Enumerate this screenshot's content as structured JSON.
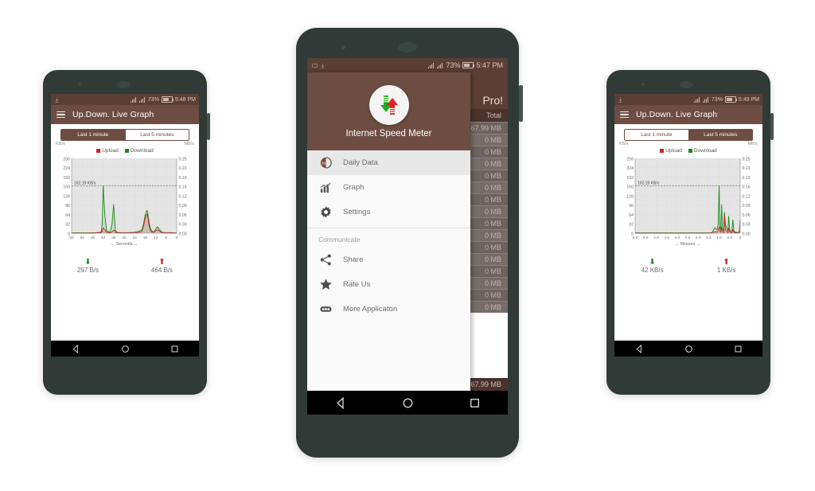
{
  "app": {
    "name": "Internet Speed Meter",
    "toolbar_title": "Up.Down. Live Graph",
    "accent": "#6d4c41",
    "status_accent": "#5b3f35",
    "upload_color": "#d32020",
    "download_color": "#1a8a1a"
  },
  "phones": {
    "left": {
      "status": {
        "battery": "73%",
        "time": "5:48 PM",
        "battery_icon": "battery-icon",
        "signal_icon": "signal-icon"
      },
      "toolbar": {
        "menu_icon": "hamburger-icon",
        "title": "Up.Down. Live Graph"
      },
      "tabs": [
        {
          "label": "Last 1 minute",
          "selected": true
        },
        {
          "label": "Last 5 minutes",
          "selected": false
        }
      ],
      "units": {
        "left": "KB/s",
        "right": "MB/s"
      },
      "legend": [
        {
          "label": "Upload",
          "color": "#d32020"
        },
        {
          "label": "Download",
          "color": "#1a8a1a"
        }
      ],
      "peak_label": "162.19 KB/s",
      "stats": {
        "download": {
          "icon": "download-arrow-icon",
          "value": "297 B/s"
        },
        "upload": {
          "icon": "upload-arrow-icon",
          "value": "464 B/s"
        }
      },
      "nav": {
        "back": "back-icon",
        "home": "home-icon",
        "recents": "recents-icon"
      }
    },
    "center": {
      "status": {
        "battery": "73%",
        "time": "5:47 PM",
        "battery_icon": "battery-icon",
        "signal_icon": "signal-icon"
      },
      "background": {
        "title": "Pro!",
        "column_header": "Total",
        "rows": [
          "67.99 MB",
          "0 MB",
          "0 MB",
          "0 MB",
          "0 MB",
          "0 MB",
          "0 MB",
          "0 MB",
          "0 MB",
          "0 MB",
          "0 MB",
          "0 MB",
          "0 MB",
          "0 MB",
          "0 MB",
          "0 MB"
        ],
        "footer_total": "67.99 MB"
      },
      "drawer": {
        "app_title": "Internet Speed Meter",
        "logo_icon": "speed-meter-logo-icon",
        "items": [
          {
            "label": "Daily Data",
            "icon": "daily-data-icon",
            "selected": true
          },
          {
            "label": "Graph",
            "icon": "bar-chart-icon",
            "selected": false
          },
          {
            "label": "Settings",
            "icon": "gear-icon",
            "selected": false
          }
        ],
        "section_label": "Communicate",
        "comm_items": [
          {
            "label": "Share",
            "icon": "share-icon"
          },
          {
            "label": "Rate Us",
            "icon": "star-icon"
          },
          {
            "label": "More Applicaton",
            "icon": "more-apps-icon"
          }
        ]
      },
      "nav": {
        "back": "back-icon",
        "home": "home-icon",
        "recents": "recents-icon"
      }
    },
    "right": {
      "status": {
        "battery": "73%",
        "time": "5:49 PM",
        "battery_icon": "battery-icon",
        "signal_icon": "signal-icon"
      },
      "toolbar": {
        "menu_icon": "hamburger-icon",
        "title": "Up.Down. Live Graph"
      },
      "tabs": [
        {
          "label": "Last 1 minute",
          "selected": false
        },
        {
          "label": "Last 5 minutes",
          "selected": true
        }
      ],
      "units": {
        "left": "KB/s",
        "right": "MB/s"
      },
      "legend": [
        {
          "label": "Upload",
          "color": "#d32020"
        },
        {
          "label": "Download",
          "color": "#1a8a1a"
        }
      ],
      "peak_label": "162.19 KB/s",
      "stats": {
        "download": {
          "icon": "download-arrow-icon",
          "value": "42 KB/s"
        },
        "upload": {
          "icon": "upload-arrow-icon",
          "value": "1 KB/s"
        }
      },
      "nav": {
        "back": "back-icon",
        "home": "home-icon",
        "recents": "recents-icon"
      }
    }
  },
  "chart_data": [
    {
      "id": "left-live-graph",
      "type": "line",
      "title": "",
      "xlabel": "← Seconds →",
      "ylabel": "KB/s",
      "y2label": "MB/s",
      "xlim": [
        60,
        0
      ],
      "ylim": [
        0,
        256
      ],
      "y2lim": [
        0.0,
        0.25
      ],
      "grid": true,
      "legend": [
        "Upload",
        "Download"
      ],
      "annotation": "162.19 KB/s",
      "annotation_y": 162.19,
      "xticks": [
        60,
        54,
        48,
        42,
        36,
        30,
        24,
        18,
        12,
        6,
        0
      ],
      "yticks": [
        0,
        32,
        64,
        96,
        128,
        160,
        192,
        224,
        256
      ],
      "y2ticks": [
        "0.00",
        "0.03",
        "0.06",
        "0.09",
        "0.12",
        "0.16",
        "0.19",
        "0.22",
        "0.25"
      ],
      "series": [
        {
          "name": "Download",
          "color": "#1a8a1a",
          "x": [
            60,
            55,
            50,
            46,
            44,
            43,
            42.5,
            42,
            41,
            40,
            38,
            37,
            36,
            35.5,
            35,
            34,
            32,
            28,
            24,
            22,
            20,
            19,
            18,
            17,
            16.5,
            16,
            15,
            14,
            13,
            12,
            11,
            10,
            9,
            8,
            7,
            6,
            5,
            4,
            3,
            2,
            1,
            0
          ],
          "y": [
            1,
            1,
            1,
            2,
            3,
            6,
            40,
            162,
            60,
            8,
            3,
            30,
            98,
            55,
            10,
            3,
            2,
            2,
            3,
            6,
            10,
            30,
            62,
            78,
            70,
            46,
            16,
            6,
            5,
            14,
            22,
            14,
            6,
            3,
            2,
            2,
            2,
            2,
            2,
            2,
            1,
            1
          ]
        },
        {
          "name": "Upload",
          "color": "#d32020",
          "x": [
            60,
            55,
            50,
            46,
            44,
            43,
            42.5,
            42,
            41,
            40,
            38,
            37,
            36,
            35.5,
            35,
            34,
            32,
            28,
            24,
            22,
            20,
            19,
            18,
            17,
            16.5,
            16,
            15,
            14,
            13,
            12,
            11,
            10,
            9,
            8,
            7,
            6,
            5,
            4,
            3,
            2,
            1,
            0
          ],
          "y": [
            0,
            0,
            0,
            1,
            1,
            2,
            8,
            18,
            12,
            3,
            1,
            4,
            10,
            9,
            3,
            1,
            1,
            1,
            1,
            2,
            5,
            22,
            50,
            66,
            58,
            32,
            8,
            3,
            3,
            8,
            12,
            8,
            3,
            2,
            1,
            1,
            1,
            1,
            1,
            1,
            0,
            0
          ]
        }
      ]
    },
    {
      "id": "right-live-graph",
      "type": "line",
      "title": "",
      "xlabel": "← Minutes →",
      "ylabel": "KB/s",
      "y2label": "MB/s",
      "xlim": [
        5.0,
        0
      ],
      "ylim": [
        0,
        256
      ],
      "y2lim": [
        0.0,
        0.25
      ],
      "grid": true,
      "legend": [
        "Upload",
        "Download"
      ],
      "annotation": "162.19 KB/s",
      "annotation_y": 162.19,
      "xticks": [
        "5.0",
        "4.5",
        "4.0",
        "3.5",
        "3.0",
        "2.5",
        "2.0",
        "1.5",
        "1.0",
        "0.5",
        "0"
      ],
      "yticks": [
        0,
        32,
        64,
        96,
        128,
        160,
        192,
        224,
        256
      ],
      "y2ticks": [
        "0.00",
        "0.03",
        "0.06",
        "0.09",
        "0.12",
        "0.16",
        "0.19",
        "0.22",
        "0.25"
      ],
      "series": [
        {
          "name": "Download",
          "color": "#1a8a1a",
          "x": [
            5.0,
            4.5,
            4.0,
            3.5,
            3.0,
            2.5,
            2.0,
            1.6,
            1.35,
            1.2,
            1.1,
            1.05,
            1.0,
            0.97,
            0.92,
            0.88,
            0.85,
            0.8,
            0.78,
            0.75,
            0.7,
            0.62,
            0.58,
            0.55,
            0.5,
            0.45,
            0.4,
            0.35,
            0.3,
            0.25,
            0.2,
            0.15,
            0.1,
            0.05,
            0
          ],
          "y": [
            1,
            1,
            1,
            1,
            1,
            1,
            1,
            1,
            2,
            18,
            12,
            30,
            162,
            30,
            10,
            98,
            20,
            8,
            14,
            72,
            30,
            12,
            8,
            58,
            12,
            6,
            4,
            46,
            8,
            4,
            3,
            3,
            3,
            2,
            44
          ]
        },
        {
          "name": "Upload",
          "color": "#d32020",
          "x": [
            5.0,
            4.5,
            4.0,
            3.5,
            3.0,
            2.5,
            2.0,
            1.6,
            1.35,
            1.2,
            1.1,
            1.05,
            1.0,
            0.97,
            0.92,
            0.88,
            0.85,
            0.8,
            0.78,
            0.75,
            0.7,
            0.62,
            0.58,
            0.55,
            0.5,
            0.45,
            0.4,
            0.35,
            0.3,
            0.25,
            0.2,
            0.15,
            0.1,
            0.05,
            0
          ],
          "y": [
            0,
            0,
            0,
            0,
            0,
            0,
            0,
            0,
            1,
            5,
            4,
            8,
            22,
            8,
            3,
            20,
            6,
            2,
            4,
            62,
            10,
            4,
            2,
            18,
            4,
            2,
            1,
            12,
            3,
            1,
            1,
            1,
            1,
            1,
            10
          ]
        }
      ]
    }
  ]
}
